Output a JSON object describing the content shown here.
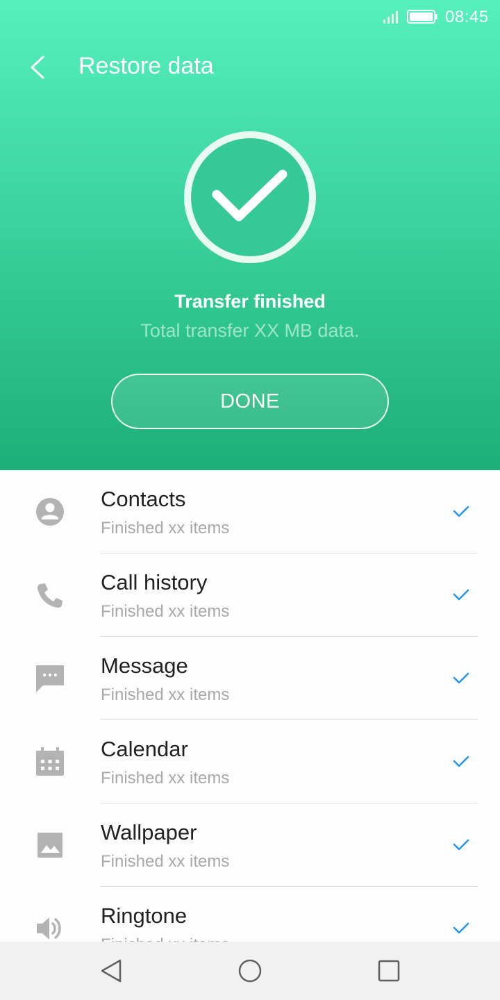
{
  "status_bar": {
    "time": "08:45",
    "signal_icon": "signal-icon",
    "battery_icon": "battery-icon"
  },
  "header": {
    "title": "Restore data",
    "back_icon": "chevron-left-icon"
  },
  "result": {
    "icon": "check-circle-icon",
    "title": "Transfer finished",
    "subtitle": "Total transfer XX MB data.",
    "done_label": "DONE"
  },
  "items": [
    {
      "title": "Contacts",
      "subtitle": "Finished xx items",
      "icon": "contact-icon"
    },
    {
      "title": "Call history",
      "subtitle": "Finished xx items",
      "icon": "phone-icon"
    },
    {
      "title": "Message",
      "subtitle": "Finished xx items",
      "icon": "message-icon"
    },
    {
      "title": "Calendar",
      "subtitle": "Finished xx items",
      "icon": "calendar-icon"
    },
    {
      "title": "Wallpaper",
      "subtitle": "Finished xx items",
      "icon": "image-icon"
    },
    {
      "title": "Ringtone",
      "subtitle": "Finished xx items",
      "icon": "volume-icon"
    }
  ],
  "nav": {
    "back_icon": "nav-back-icon",
    "home_icon": "nav-home-icon",
    "recents_icon": "nav-recents-icon"
  },
  "colors": {
    "accent_top": "#56f0bd",
    "accent_bottom": "#1daf78",
    "check_blue": "#2196f3",
    "icon_gray": "#b3b3b3"
  }
}
